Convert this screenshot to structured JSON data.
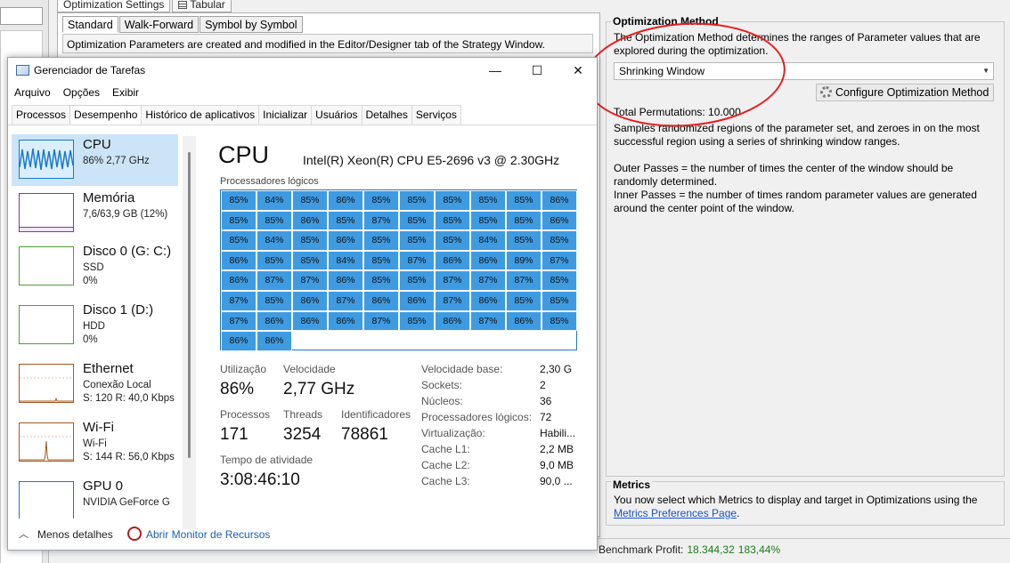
{
  "background": {
    "tabs": [
      {
        "label": "Optimization Settings"
      },
      {
        "label": "Tabular"
      }
    ],
    "sub_tabs": [
      {
        "label": "Standard"
      },
      {
        "label": "Walk-Forward"
      },
      {
        "label": "Symbol by Symbol"
      }
    ],
    "description": "Optimization Parameters are created and modified in the Editor/Designer tab of the Strategy Window.",
    "optimization_method": {
      "title": "Optimization Method",
      "intro": "The Optimization Method determines the ranges of Parameter values that are explored during the optimization.",
      "selected": "Shrinking Window",
      "configure_label": "Configure Optimization Method",
      "total_permutations": "Total Permutations: 10.000",
      "desc1": "Samples randomized regions of the parameter set, and zeroes in on the most successful region using a series of shrinking window ranges.",
      "desc2": "Outer Passes = the number of times the center of the window should be randomly determined.",
      "desc3": "Inner Passes = the number of times random parameter values are generated around the center point of the window."
    },
    "metrics": {
      "title": "Metrics",
      "text": "You now select which Metrics to display and target in Optimizations using the",
      "link": "Metrics Preferences Page",
      "suffix": "."
    },
    "status": {
      "benchmark_label": "Benchmark Profit:",
      "benchmark_value": "18.344,32",
      "benchmark_pct": "183,44%"
    }
  },
  "task_manager": {
    "title": "Gerenciador de Tarefas",
    "window_buttons": {
      "minimize": "—",
      "maximize": "☐",
      "close": "✕"
    },
    "menu": [
      "Arquivo",
      "Opções",
      "Exibir"
    ],
    "tabs": [
      "Processos",
      "Desempenho",
      "Histórico de aplicativos",
      "Inicializar",
      "Usuários",
      "Detalhes",
      "Serviços"
    ],
    "devices": [
      {
        "name": "CPU",
        "line1": "86% 2,77 GHz",
        "line2": ""
      },
      {
        "name": "Memória",
        "line1": "7,6/63,9 GB (12%)",
        "line2": ""
      },
      {
        "name": "Disco 0 (G: C:)",
        "line1": "SSD",
        "line2": "0%"
      },
      {
        "name": "Disco 1 (D:)",
        "line1": "HDD",
        "line2": "0%"
      },
      {
        "name": "Ethernet",
        "line1": "Conexão Local",
        "line2": "S: 120 R: 40,0 Kbps"
      },
      {
        "name": "Wi-Fi",
        "line1": "Wi-Fi",
        "line2": "S: 144 R: 56,0 Kbps"
      },
      {
        "name": "GPU 0",
        "line1": "NVIDIA GeForce G",
        "line2": ""
      }
    ],
    "cpu": {
      "title": "CPU",
      "model": "Intel(R) Xeon(R) CPU E5-2696 v3 @ 2.30GHz",
      "logical_label": "Processadores lógicos",
      "cores": [
        "85%",
        "84%",
        "85%",
        "86%",
        "85%",
        "85%",
        "85%",
        "85%",
        "85%",
        "86%",
        "85%",
        "85%",
        "86%",
        "85%",
        "87%",
        "85%",
        "85%",
        "85%",
        "85%",
        "86%",
        "85%",
        "84%",
        "85%",
        "86%",
        "85%",
        "85%",
        "85%",
        "84%",
        "85%",
        "85%",
        "86%",
        "85%",
        "85%",
        "84%",
        "85%",
        "87%",
        "86%",
        "86%",
        "89%",
        "87%",
        "86%",
        "87%",
        "87%",
        "86%",
        "85%",
        "85%",
        "87%",
        "87%",
        "87%",
        "85%",
        "87%",
        "85%",
        "86%",
        "87%",
        "86%",
        "86%",
        "87%",
        "86%",
        "85%",
        "85%",
        "87%",
        "86%",
        "86%",
        "86%",
        "87%",
        "85%",
        "86%",
        "87%",
        "86%",
        "85%",
        "86%",
        "86%"
      ],
      "utilizacao_label": "Utilização",
      "utilizacao": "86%",
      "velocidade_label": "Velocidade",
      "velocidade": "2,77 GHz",
      "processos_label": "Processos",
      "processos": "171",
      "threads_label": "Threads",
      "threads": "3254",
      "ids_label": "Identificadores",
      "ids": "78861",
      "uptime_label": "Tempo de atividade",
      "uptime": "3:08:46:10",
      "specs": [
        {
          "label": "Velocidade base:",
          "value": "2,30 G"
        },
        {
          "label": "Sockets:",
          "value": "2"
        },
        {
          "label": "Núcleos:",
          "value": "36"
        },
        {
          "label": "Processadores lógicos:",
          "value": "72"
        },
        {
          "label": "Virtualização:",
          "value": "Habili..."
        },
        {
          "label": "Cache L1:",
          "value": "2,2 MB"
        },
        {
          "label": "Cache L2:",
          "value": "9,0 MB"
        },
        {
          "label": "Cache L3:",
          "value": "90,0 ..."
        }
      ]
    },
    "footer": {
      "less": "Menos detalhes",
      "resource_monitor": "Abrir Monitor de Recursos"
    }
  }
}
